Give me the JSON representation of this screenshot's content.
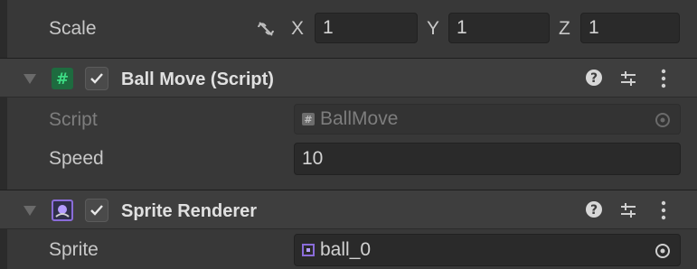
{
  "scale": {
    "label": "Scale",
    "x_label": "X",
    "x_value": "1",
    "y_label": "Y",
    "y_value": "1",
    "z_label": "Z",
    "z_value": "1"
  },
  "ball_move": {
    "title": "Ball Move (Script)",
    "script_label": "Script",
    "script_value": "BallMove",
    "speed_label": "Speed",
    "speed_value": "10"
  },
  "sprite_renderer": {
    "title": "Sprite Renderer",
    "sprite_label": "Sprite",
    "sprite_value": "ball_0"
  },
  "icons": {
    "link": "unlink-icon",
    "help": "help-icon",
    "presets": "presets-icon",
    "menu": "kebab-menu-icon",
    "script": "script-icon",
    "sprite": "sprite-renderer-icon",
    "picker": "object-picker-icon"
  },
  "colors": {
    "script_icon": "#1fa35a",
    "sprite_icon": "#8a6cd9",
    "background": "#383838",
    "header": "#3e3e3e"
  }
}
